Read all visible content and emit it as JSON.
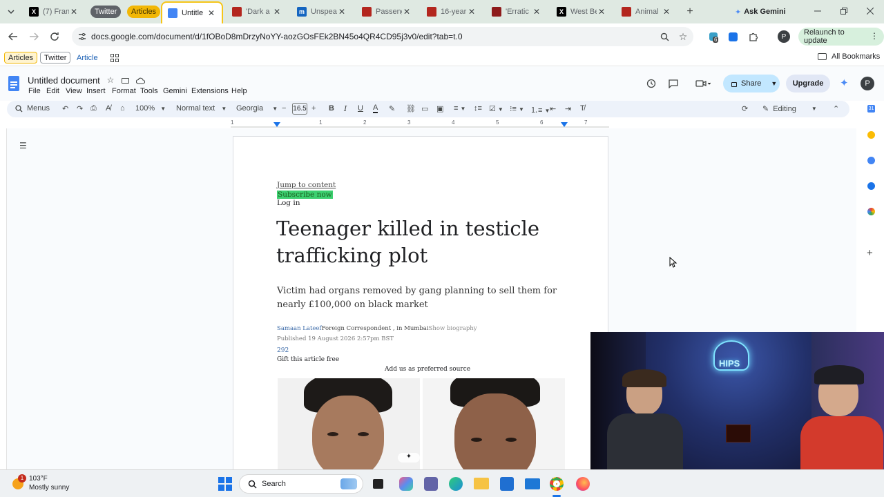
{
  "browser": {
    "tabs": [
      {
        "title": "(7) Fran",
        "favicon": "x-icon"
      },
      {
        "title": "Twitter",
        "favicon": "group-pill"
      },
      {
        "title": "Articles",
        "favicon": "group-pill"
      },
      {
        "title": "Untitle",
        "favicon": "docs-icon"
      },
      {
        "title": "'Dark a",
        "favicon": "news-icon"
      },
      {
        "title": "Unspea",
        "favicon": "m-icon"
      },
      {
        "title": "Passeng",
        "favicon": "news-icon"
      },
      {
        "title": "16-year",
        "favicon": "news-icon"
      },
      {
        "title": "'Erratic",
        "favicon": "news-icon"
      },
      {
        "title": "West Be",
        "favicon": "x-icon"
      },
      {
        "title": "Animal",
        "favicon": "news-icon"
      }
    ],
    "ask_gemini": "Ask Gemini",
    "url": "docs.google.com/document/d/1fOBoD8mDrzyNoYY-aozGOsFEk2BN45o4QR4CD95j3v0/edit?tab=t.0",
    "relaunch": "Relaunch to update",
    "extension_badge": "6",
    "profile_initial": "P",
    "bookmarks": [
      "Articles",
      "Twitter",
      "Article"
    ],
    "all_bookmarks": "All Bookmarks"
  },
  "docs": {
    "title": "Untitled document",
    "menus": [
      "File",
      "Edit",
      "View",
      "Insert",
      "Format",
      "Tools",
      "Gemini",
      "Extensions",
      "Help"
    ],
    "share": "Share",
    "upgrade": "Upgrade",
    "profile_initial": "P",
    "toolbar": {
      "menus": "Menus",
      "zoom": "100%",
      "style": "Normal text",
      "font": "Georgia",
      "size": "16.5",
      "mode": "Editing"
    },
    "ruler_numbers": [
      "1",
      "1",
      "2",
      "3",
      "4",
      "5",
      "6",
      "7"
    ],
    "content": {
      "jump": "Jump to content",
      "subscribe": "Subscribe now",
      "login": "Log in",
      "headline_line1": "Teenager killed in testicle",
      "headline_line2": "trafficking plot",
      "standfirst_line1": "Victim had organs removed by gang planning to sell them for",
      "standfirst_line2": "nearly £100,000 on black market",
      "author": "Samaan Lateef",
      "role": "Foreign Correspondent , in Mumbai",
      "bio": "Show biography",
      "published": "Published 19 August 2026 2:57pm BST",
      "comments": "292",
      "gift": "Gift this article free",
      "preferred": "Add us as preferred source"
    }
  },
  "taskbar": {
    "weather_temp": "103°F",
    "weather_desc": "Mostly sunny",
    "weather_badge": "1",
    "search": "Search"
  },
  "webcam": {
    "sign": "HIPS"
  },
  "colors": {
    "tabstrip": "#dfe9e2",
    "subscribe_highlight": "#3cd070",
    "link_blue": "#3b6aa8",
    "upgrade_bg": "#e1e7f5",
    "relaunch_bg": "#d7f0dd"
  }
}
